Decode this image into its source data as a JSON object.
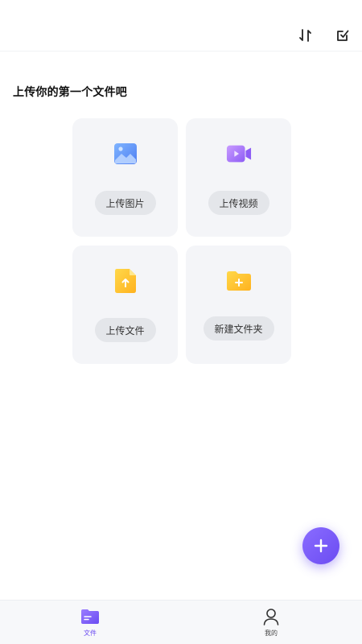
{
  "topbar": {
    "sort_icon": "sort-icon",
    "edit_icon": "edit-check-icon"
  },
  "main": {
    "heading": "上传你的第一个文件吧",
    "cards": [
      {
        "label": "上传图片",
        "icon": "image-icon"
      },
      {
        "label": "上传视频",
        "icon": "video-icon"
      },
      {
        "label": "上传文件",
        "icon": "upload-file-icon"
      },
      {
        "label": "新建文件夹",
        "icon": "new-folder-icon"
      }
    ]
  },
  "fab": {
    "icon": "plus-icon"
  },
  "bottom_nav": {
    "items": [
      {
        "label": "文件",
        "icon": "folder-tab-icon",
        "active": true
      },
      {
        "label": "我的",
        "icon": "profile-icon",
        "active": false
      }
    ]
  },
  "colors": {
    "accent": "#6b4cf2",
    "card_bg": "#f4f5f8",
    "pill_bg": "#e4e6ea"
  }
}
